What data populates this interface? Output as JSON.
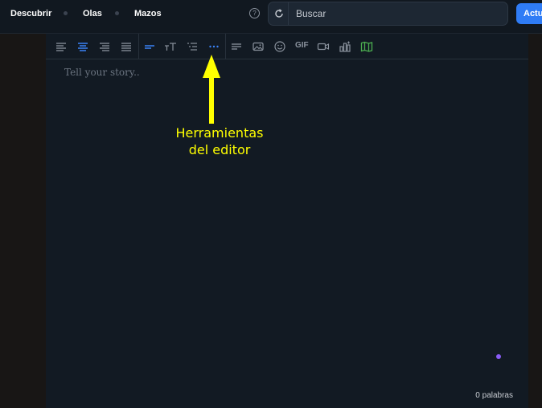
{
  "nav": {
    "items": [
      {
        "label": "Descubrir"
      },
      {
        "label": "Olas"
      },
      {
        "label": "Mazos"
      }
    ],
    "help_label": "?"
  },
  "search": {
    "placeholder": "Buscar"
  },
  "update_button": {
    "label": "Actualizar"
  },
  "toolbar": {
    "gif_label": "GIF",
    "icons": [
      "align-left-icon",
      "align-center-icon",
      "align-right-icon",
      "align-justify-icon",
      "heading-icon",
      "text-size-icon",
      "list-icon",
      "more-icon",
      "paragraph-icon",
      "image-icon",
      "emoji-icon",
      "gif-icon",
      "video-icon",
      "chart-icon",
      "map-icon"
    ],
    "active": [
      "align-center-icon",
      "heading-icon",
      "more-icon"
    ]
  },
  "editor": {
    "placeholder": "Tell your story..",
    "word_count": "0 palabras"
  },
  "annotation": {
    "line1": "Herramientas",
    "line2": "del editor",
    "color": "#ffff00"
  },
  "colors": {
    "accent": "#2f7cf6",
    "active_icon": "#3b82f6",
    "map_icon": "#4caf50",
    "dot": "#8a5cf6",
    "background": "#121a23"
  }
}
